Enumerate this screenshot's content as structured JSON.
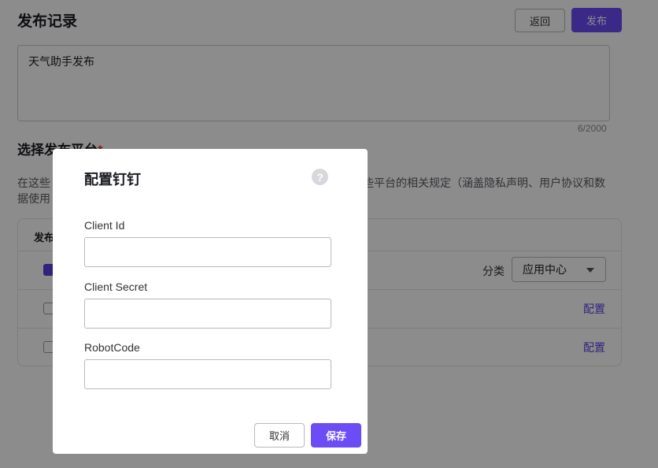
{
  "page": {
    "title": "发布记录",
    "back_label": "返回",
    "publish_label": "发布",
    "record_text": "天气助手发布",
    "counter": "6/2000",
    "section_title": "选择发布平台",
    "required_mark": "*",
    "notice_part1": "在这些",
    "notice_part2": "些平台的相关规定（涵盖隐私声明、用户协议和数",
    "notice_part3": "据使用",
    "table_header": "发布",
    "rows": [
      {
        "checked": true
      },
      {
        "checked": false
      },
      {
        "checked": false
      }
    ],
    "category_label": "分类",
    "category_value": "应用中心",
    "config_label": "配置"
  },
  "modal": {
    "title": "配置钉钉",
    "help_icon": "question-circle-icon",
    "fields": [
      {
        "label": "Client Id",
        "value": ""
      },
      {
        "label": "Client Secret",
        "value": ""
      },
      {
        "label": "RobotCode",
        "value": ""
      }
    ],
    "cancel_label": "取消",
    "save_label": "保存"
  },
  "colors": {
    "accent": "#6b4cf6",
    "required": "#e5322d",
    "overlay": "rgba(0,0,0,0.45)"
  }
}
